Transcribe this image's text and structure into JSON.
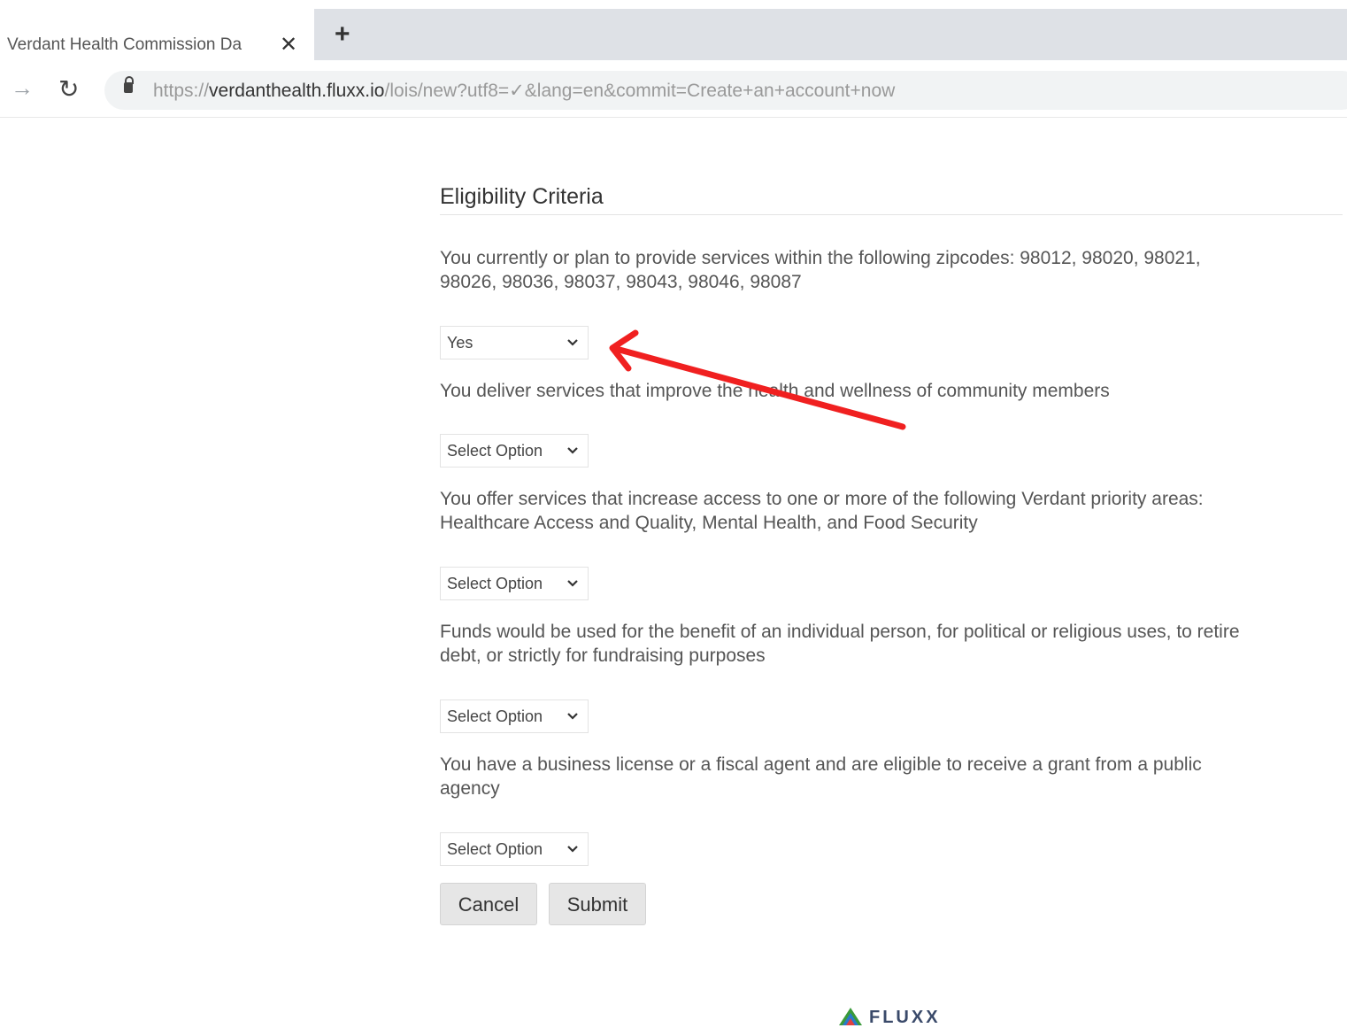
{
  "browser": {
    "tab_title": "Verdant Health Commission Da",
    "tab_close": "✕",
    "new_tab": "+",
    "url_scheme": "https://",
    "url_host": "verdanthealth.fluxx.io",
    "url_path": "/lois/new?utf8=✓&lang=en&commit=Create+an+account+now"
  },
  "form": {
    "title": "Eligibility Criteria",
    "questions": [
      {
        "text": "You currently or plan to provide services within the following zipcodes: 98012, 98020, 98021, 98026, 98036, 98037, 98043, 98046, 98087",
        "selected": "Yes"
      },
      {
        "text": "You deliver services that improve the health and wellness of community members",
        "selected": "Select Option"
      },
      {
        "text": "You offer services that increase access to one or more of the following Verdant priority areas: Healthcare Access and Quality, Mental Health, and Food Security",
        "selected": "Select Option"
      },
      {
        "text": "Funds would be used for the benefit of an individual person, for political or religious uses, to retire debt, or strictly for fundraising purposes",
        "selected": "Select Option"
      },
      {
        "text": "You have a business license or a fiscal agent and are eligible to receive a grant from a public agency",
        "selected": "Select Option"
      }
    ],
    "cancel_label": "Cancel",
    "submit_label": "Submit"
  },
  "footer": {
    "logo_text": "FLUXX"
  },
  "colors": {
    "annotation_arrow": "#f02020"
  }
}
